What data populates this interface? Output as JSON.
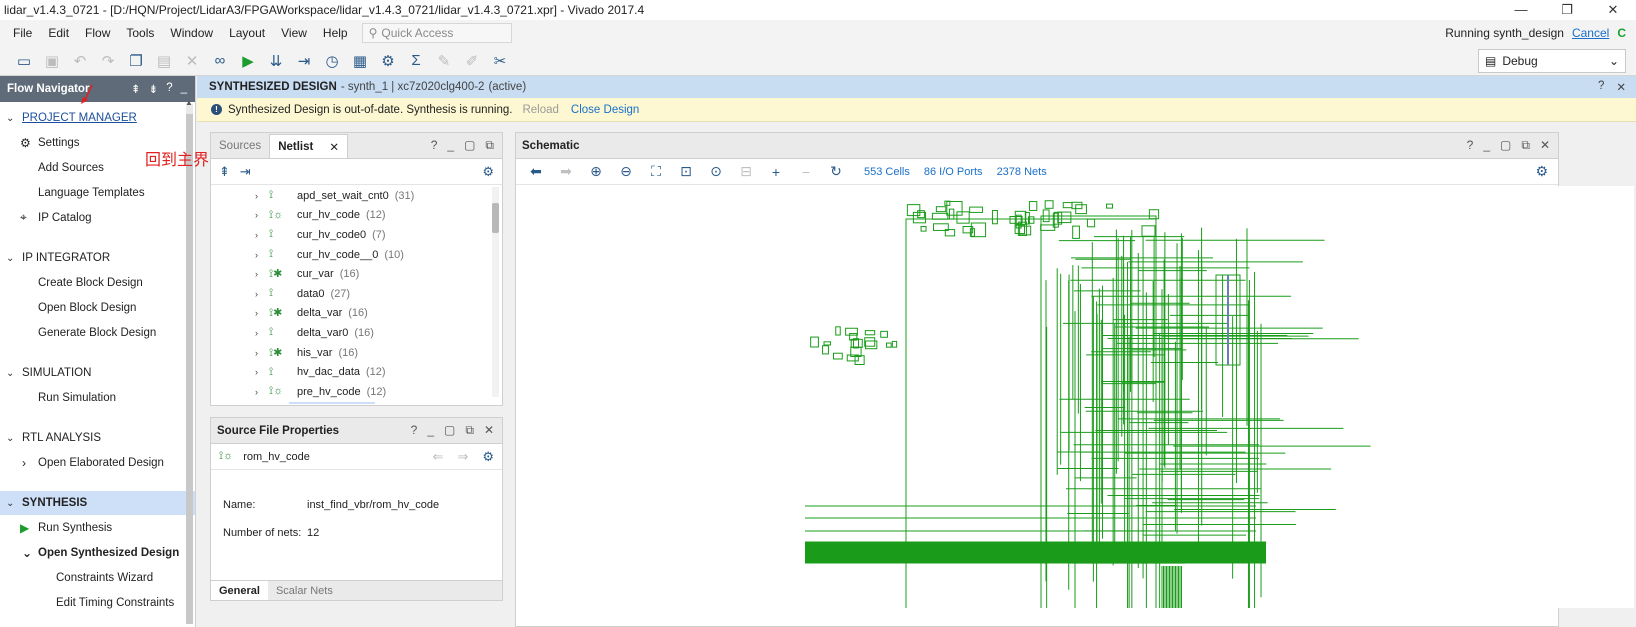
{
  "window": {
    "title": "lidar_v1.4.3_0721 - [D:/HQN/Project/LidarA3/FPGAWorkspace/lidar_v1.4.3_0721/lidar_v1.4.3_0721.xpr] - Vivado 2017.4",
    "minimize": "—",
    "restore": "❐",
    "close": "✕"
  },
  "menu": {
    "items": [
      "File",
      "Edit",
      "Flow",
      "Tools",
      "Window",
      "Layout",
      "View",
      "Help"
    ],
    "quick_access_placeholder": "Quick Access",
    "status": "Running synth_design",
    "cancel": "Cancel",
    "spinner": "C"
  },
  "toolbar": {
    "layout_value": "Debug"
  },
  "flow_navigator": {
    "title": "Flow Navigator",
    "sections": {
      "project_manager": "PROJECT MANAGER",
      "ip_integrator": "IP INTEGRATOR",
      "simulation": "SIMULATION",
      "rtl_analysis": "RTL ANALYSIS",
      "synthesis": "SYNTHESIS"
    },
    "items": {
      "settings": "Settings",
      "add_sources": "Add Sources",
      "language_templates": "Language Templates",
      "ip_catalog": "IP Catalog",
      "create_block_design": "Create Block Design",
      "open_block_design": "Open Block Design",
      "generate_block_design": "Generate Block Design",
      "run_simulation": "Run Simulation",
      "open_elaborated_design": "Open Elaborated Design",
      "run_synthesis": "Run Synthesis",
      "open_synthesized_design": "Open Synthesized Design",
      "constraints_wizard": "Constraints Wizard",
      "edit_timing_constraints": "Edit Timing Constraints"
    }
  },
  "annotation": {
    "text": "回到主界面",
    "color": "#e02020"
  },
  "design_header": {
    "title": "SYNTHESIZED DESIGN",
    "subtitle": "- synth_1 | xc7z020clg400-2",
    "state": "(active)"
  },
  "warning": {
    "message": "Synthesized Design is out-of-date. Synthesis is running.",
    "reload": "Reload",
    "close_design": "Close Design"
  },
  "sources_panel": {
    "tab_sources": "Sources",
    "tab_netlist": "Netlist",
    "nets": [
      {
        "name": "apd_set_wait_cnt0",
        "count": "(31)",
        "icon": "⟟"
      },
      {
        "name": "cur_hv_code",
        "count": "(12)",
        "icon": "⟟☼"
      },
      {
        "name": "cur_hv_code0",
        "count": "(7)",
        "icon": "⟟"
      },
      {
        "name": "cur_hv_code__0",
        "count": "(10)",
        "icon": "⟟"
      },
      {
        "name": "cur_var",
        "count": "(16)",
        "icon": "⟟✱"
      },
      {
        "name": "data0",
        "count": "(27)",
        "icon": "⟟"
      },
      {
        "name": "delta_var",
        "count": "(16)",
        "icon": "⟟✱"
      },
      {
        "name": "delta_var0",
        "count": "(16)",
        "icon": "⟟"
      },
      {
        "name": "his_var",
        "count": "(16)",
        "icon": "⟟✱"
      },
      {
        "name": "hv_dac_data",
        "count": "(12)",
        "icon": "⟟"
      },
      {
        "name": "pre_hv_code",
        "count": "(12)",
        "icon": "⟟☼"
      }
    ]
  },
  "properties_panel": {
    "title": "Source File Properties",
    "object": "rom_hv_code",
    "name_label": "Name:",
    "name_value": "inst_find_vbr/rom_hv_code",
    "nets_label": "Number of nets:",
    "nets_value": "12",
    "tab_general": "General",
    "tab_scalar": "Scalar Nets"
  },
  "schematic": {
    "title": "Schematic",
    "cells": "553 Cells",
    "ports": "86 I/O Ports",
    "nets": "2378 Nets",
    "wire_color": "#1a9c1a"
  }
}
